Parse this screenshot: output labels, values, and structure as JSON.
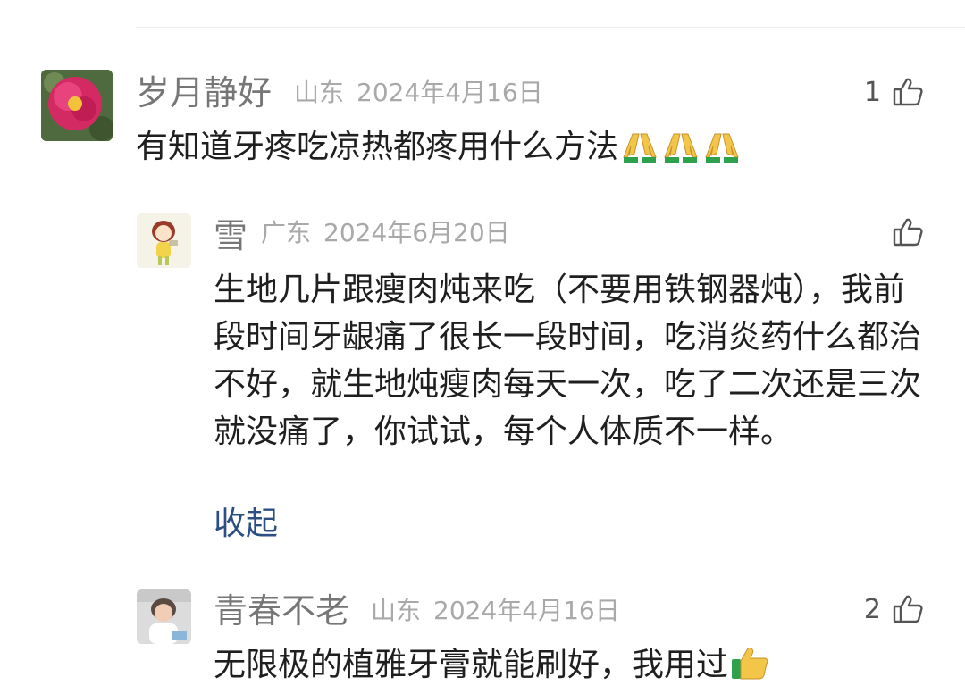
{
  "comments": [
    {
      "user": "岁月静好",
      "location": "山东",
      "date": "2024年4月16日",
      "likes": "1",
      "text": "有知道牙疼吃凉热都疼用什么方法",
      "emoji": [
        "pray-emoji",
        "pray-emoji",
        "pray-emoji"
      ],
      "avatar": "peony-flower-avatar"
    },
    {
      "user": "雪",
      "location": "广东",
      "date": "2024年6月20日",
      "likes": "",
      "text": "生地几片跟瘦肉炖来吃（不要用铁钢器炖），我前段时间牙龈痛了很长一段时间，吃消炎药什么都治不好，就生地炖瘦肉每天一次，吃了二次还是三次就没痛了，你试试，每个人体质不一样。",
      "collapse_label": "收起",
      "avatar": "cartoon-girl-avatar"
    },
    {
      "user": "青春不老",
      "location": "山东",
      "date": "2024年4月16日",
      "likes": "2",
      "text": "无限极的植雅牙膏就能刷好，我用过",
      "emoji": [
        "thumbs-up-emoji"
      ],
      "avatar": "woman-portrait-avatar"
    }
  ],
  "colors": {
    "name": "#767676",
    "meta": "#a9a9a9",
    "body": "#1f1f1f",
    "link": "#2c4f83"
  }
}
